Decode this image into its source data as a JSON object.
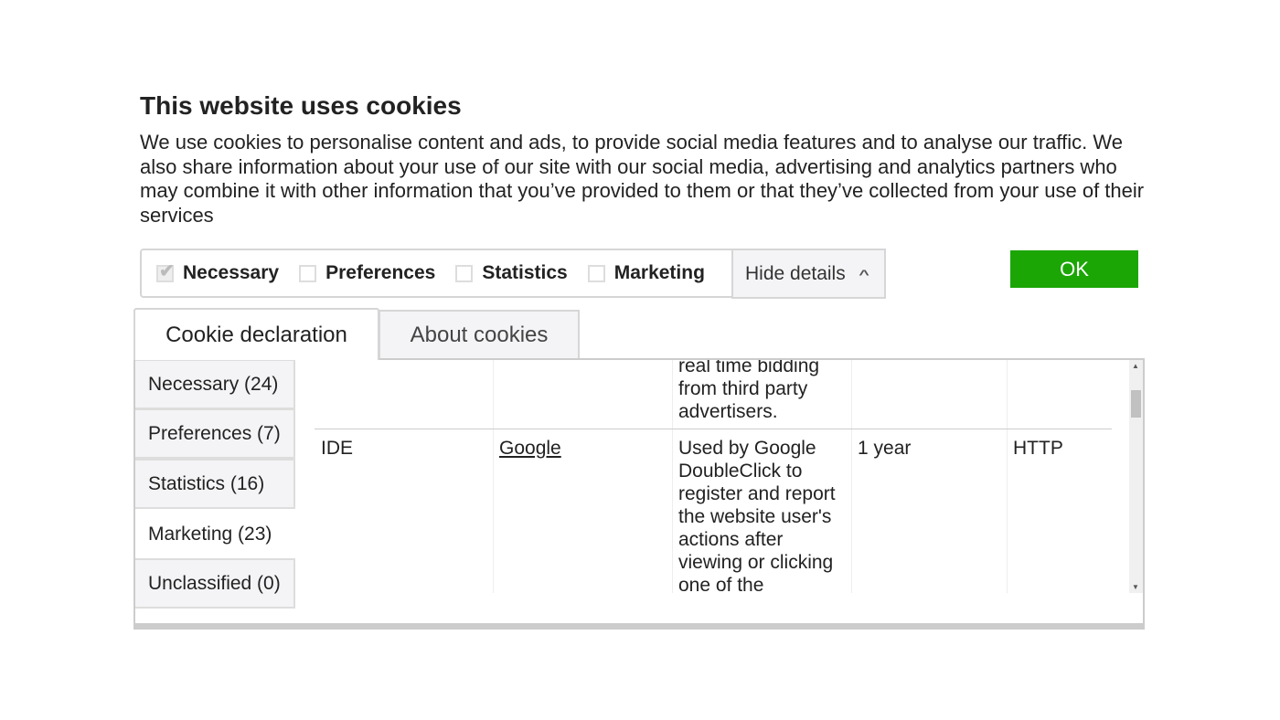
{
  "banner": {
    "title": "This website uses cookies",
    "intro": "We use cookies to personalise content and ads, to provide social media features and to analyse our traffic. We also share information about your use of our site with our social media, advertising and analytics partners who may combine it with other information that you’ve provided to them or that they’ve collected from your use of their services"
  },
  "consent": {
    "checkboxes": [
      {
        "label": "Necessary",
        "checked": true,
        "disabled": true
      },
      {
        "label": "Preferences",
        "checked": false
      },
      {
        "label": "Statistics",
        "checked": false
      },
      {
        "label": "Marketing",
        "checked": false
      }
    ],
    "hide_details": "Hide details",
    "ok": "OK",
    "ok_color": "#1ba606"
  },
  "tabs": [
    {
      "label": "Cookie declaration",
      "active": true
    },
    {
      "label": "About cookies",
      "active": false
    }
  ],
  "categories": [
    {
      "label": "Necessary (24)"
    },
    {
      "label": "Preferences (7)"
    },
    {
      "label": "Statistics (16)"
    },
    {
      "label": "Marketing (23)",
      "active": true
    },
    {
      "label": "Unclassified (0)"
    }
  ],
  "table": {
    "rows": [
      {
        "purpose_tail": "real time bidding from third party advertisers."
      },
      {
        "name": "IDE",
        "provider": "Google",
        "purpose": "Used by Google DoubleClick to register and report the website user's actions after viewing or clicking one of the",
        "expiry": "1 year",
        "type": "HTTP"
      }
    ]
  }
}
